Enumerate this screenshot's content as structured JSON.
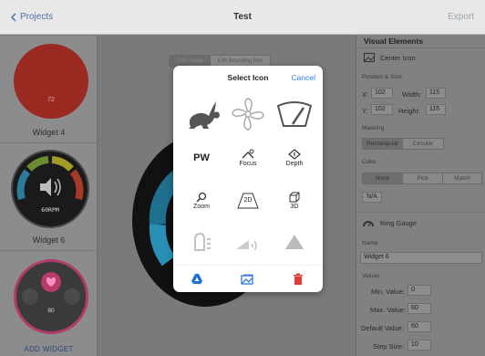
{
  "topbar": {
    "back_label": "Projects",
    "title": "Test",
    "export_label": "Export"
  },
  "sidebar": {
    "widgets": [
      {
        "label": "Widget 4",
        "value": "72"
      },
      {
        "label": "Widget 6",
        "value": "60RPM"
      },
      {
        "label": "",
        "value": "80"
      }
    ],
    "add_label": "ADD WIDGET"
  },
  "canvas": {
    "tabs": [
      "Edit Image",
      "Edit Bounding Box"
    ]
  },
  "panel": {
    "title": "Visual Elements",
    "center_icon_label": "Center Icon",
    "position_size_label": "Position & Size",
    "x_label": "X:",
    "x_value": "102",
    "y_label": "Y:",
    "y_value": "102",
    "width_label": "Width:",
    "width_value": "115",
    "height_label": "Height:",
    "height_value": "115",
    "masking_label": "Masking",
    "masking_options": [
      "Rectangular",
      "Circular"
    ],
    "color_label": "Color",
    "color_options": [
      "None",
      "Pick",
      "Match"
    ],
    "na_label": "N/A",
    "ring_gauge_label": "Ring Gauge",
    "name_label": "Name",
    "name_value": "Widget 6",
    "values_label": "Values",
    "min_label": "Min. Value:",
    "min_value": "0",
    "max_label": "Max. Value:",
    "max_value": "60",
    "default_label": "Default Value:",
    "default_value": "60",
    "step_label": "Step Size:",
    "step_value": "10"
  },
  "modal": {
    "title": "Select Icon",
    "cancel_label": "Cancel",
    "icons": [
      {
        "name": "rabbit-icon",
        "label": ""
      },
      {
        "name": "fan-icon",
        "label": ""
      },
      {
        "name": "wiper-icon",
        "label": ""
      },
      {
        "name": "pw-icon",
        "label": "PW"
      },
      {
        "name": "focus-icon",
        "label": "Focus"
      },
      {
        "name": "depth-icon",
        "label": "Depth"
      },
      {
        "name": "zoom-icon",
        "label": "Zoom"
      },
      {
        "name": "2d-icon",
        "label": "2D"
      },
      {
        "name": "3d-icon",
        "label": "3D"
      },
      {
        "name": "lights-icon",
        "label": ""
      },
      {
        "name": "signal-icon",
        "label": ""
      },
      {
        "name": "triangle-icon",
        "label": ""
      }
    ]
  },
  "colors": {
    "accent": "#2c7be5",
    "drive_blue": "#1f6fd1",
    "delete_red": "#e53935"
  }
}
